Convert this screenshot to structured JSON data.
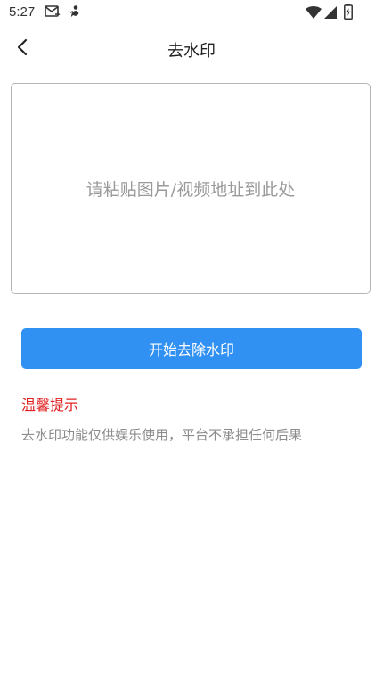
{
  "status_bar": {
    "time": "5:27",
    "icons": [
      "message-icon",
      "notification-figure-icon",
      "wifi-icon",
      "signal-icon",
      "battery-icon"
    ]
  },
  "nav": {
    "back_icon": "chevron-left-icon",
    "title": "去水印"
  },
  "paste_area": {
    "placeholder": "请粘贴图片/视频地址到此处"
  },
  "start_button": {
    "label": "开始去除水印"
  },
  "tips": {
    "title": "温馨提示",
    "text": "去水印功能仅供娱乐使用，平台不承担任何后果"
  },
  "colors": {
    "accent": "#3191f3",
    "warning": "#e02020",
    "muted": "#8c8c8c"
  }
}
